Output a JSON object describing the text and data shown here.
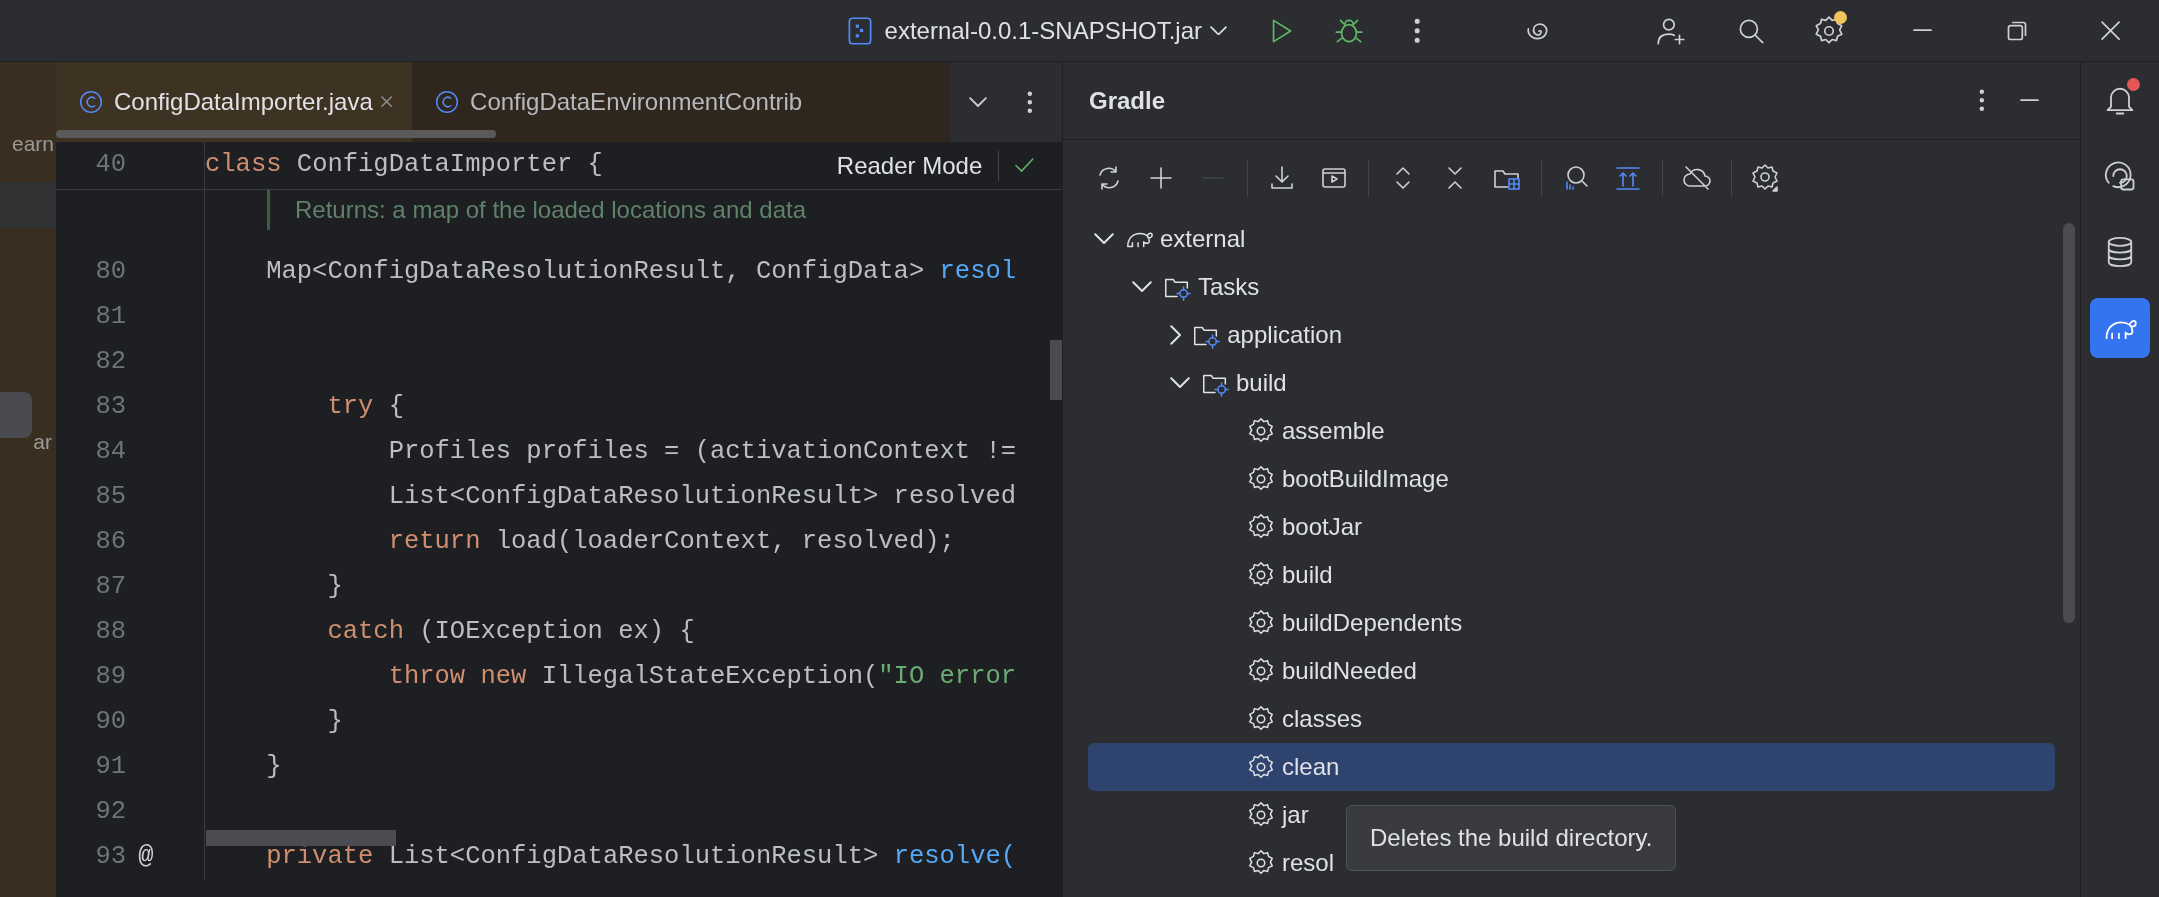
{
  "title_bar": {
    "run_config": "external-0.0.1-SNAPSHOT.jar",
    "settings_badge": true
  },
  "project_panel": {
    "fragments": [
      "earn",
      "ar"
    ]
  },
  "editor": {
    "tabs": [
      {
        "label": "ConfigDataImporter.java",
        "selected": true
      },
      {
        "label": "ConfigDataEnvironmentContrib",
        "selected": false
      }
    ],
    "sticky_line": {
      "number": "40",
      "tokens": [
        {
          "kind": "keyword",
          "text": "class "
        },
        {
          "kind": "plain",
          "text": "ConfigDataImporter {"
        }
      ]
    },
    "reader_mode": "Reader Mode",
    "doc_comment": "Returns: a map of the loaded locations and data",
    "lines": [
      {
        "number": "80",
        "tokens": [
          {
            "kind": "plain",
            "text": "    Map<ConfigDataResolutionResult, ConfigData> "
          },
          {
            "kind": "method",
            "text": "resol"
          }
        ]
      },
      {
        "number": "81"
      },
      {
        "number": "82"
      },
      {
        "number": "83",
        "tokens": [
          {
            "kind": "keyword",
            "text": "        try "
          },
          {
            "kind": "plain",
            "text": "{"
          }
        ]
      },
      {
        "number": "84",
        "tokens": [
          {
            "kind": "plain",
            "text": "            Profiles profiles = (activationContext !="
          }
        ]
      },
      {
        "number": "85",
        "tokens": [
          {
            "kind": "plain",
            "text": "            List<ConfigDataResolutionResult> resolved"
          }
        ]
      },
      {
        "number": "86",
        "tokens": [
          {
            "kind": "keyword",
            "text": "            return "
          },
          {
            "kind": "plain",
            "text": "load(loaderContext, resolved);"
          }
        ]
      },
      {
        "number": "87",
        "tokens": [
          {
            "kind": "plain",
            "text": "        }"
          }
        ]
      },
      {
        "number": "88",
        "tokens": [
          {
            "kind": "keyword",
            "text": "        catch "
          },
          {
            "kind": "plain",
            "text": "(IOException ex) {"
          }
        ]
      },
      {
        "number": "89",
        "tokens": [
          {
            "kind": "keyword",
            "text": "            throw new "
          },
          {
            "kind": "plain",
            "text": "IllegalStateException("
          },
          {
            "kind": "string",
            "text": "\"IO error"
          }
        ]
      },
      {
        "number": "90",
        "tokens": [
          {
            "kind": "plain",
            "text": "        }"
          }
        ]
      },
      {
        "number": "91",
        "tokens": [
          {
            "kind": "plain",
            "text": "    }"
          }
        ]
      },
      {
        "number": "92"
      },
      {
        "number": "93",
        "gutter_mark": "@",
        "tokens": [
          {
            "kind": "keyword",
            "text": "    private "
          },
          {
            "kind": "plain",
            "text": "List<ConfigDataResolutionResult> "
          },
          {
            "kind": "method",
            "text": "resolve("
          }
        ]
      }
    ]
  },
  "gradle": {
    "title": "Gradle",
    "toolbar": [
      {
        "kind": "reload",
        "disabled": false
      },
      {
        "kind": "add",
        "disabled": false
      },
      {
        "kind": "remove",
        "disabled": true
      },
      {
        "kind": "sep"
      },
      {
        "kind": "download",
        "disabled": false
      },
      {
        "kind": "run",
        "disabled": false
      },
      {
        "kind": "sep"
      },
      {
        "kind": "expand",
        "disabled": false
      },
      {
        "kind": "collapse",
        "disabled": false
      },
      {
        "kind": "folder",
        "disabled": false
      },
      {
        "kind": "sep"
      },
      {
        "kind": "analyze",
        "disabled": false
      },
      {
        "kind": "upload",
        "disabled": false
      },
      {
        "kind": "sep"
      },
      {
        "kind": "offline",
        "disabled": false
      },
      {
        "kind": "sep"
      },
      {
        "kind": "settings",
        "disabled": false
      }
    ],
    "tree": [
      {
        "kind": "project",
        "label": "external",
        "expanded": true,
        "selected": false,
        "children": [
          {
            "kind": "folder",
            "label": "Tasks",
            "expanded": true,
            "selected": false,
            "children": [
              {
                "kind": "folder",
                "label": "application",
                "expanded": false,
                "selected": false
              },
              {
                "kind": "folder",
                "label": "build",
                "expanded": true,
                "selected": false,
                "children": [
                  {
                    "kind": "task",
                    "label": "assemble",
                    "selected": false
                  },
                  {
                    "kind": "task",
                    "label": "bootBuildImage",
                    "selected": false
                  },
                  {
                    "kind": "task",
                    "label": "bootJar",
                    "selected": false
                  },
                  {
                    "kind": "task",
                    "label": "build",
                    "selected": false
                  },
                  {
                    "kind": "task",
                    "label": "buildDependents",
                    "selected": false
                  },
                  {
                    "kind": "task",
                    "label": "buildNeeded",
                    "selected": false
                  },
                  {
                    "kind": "task",
                    "label": "classes",
                    "selected": false
                  },
                  {
                    "kind": "task",
                    "label": "clean",
                    "selected": true
                  },
                  {
                    "kind": "task",
                    "label": "jar",
                    "selected": false
                  },
                  {
                    "kind": "task",
                    "label": "resol",
                    "selected": false
                  }
                ]
              }
            ]
          }
        ]
      }
    ],
    "tooltip": "Deletes the build directory."
  },
  "side_tools": [
    {
      "kind": "notifications",
      "selected": false,
      "badge": true
    },
    {
      "kind": "chat",
      "selected": false
    },
    {
      "kind": "database",
      "selected": false
    },
    {
      "kind": "gradle",
      "selected": true
    }
  ]
}
